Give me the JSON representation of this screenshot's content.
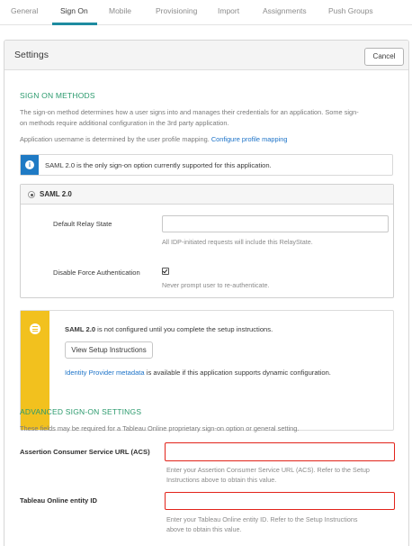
{
  "tabs": [
    {
      "label": "General"
    },
    {
      "label": "Sign On"
    },
    {
      "label": "Mobile"
    },
    {
      "label": "Provisioning"
    },
    {
      "label": "Import"
    },
    {
      "label": "Assignments"
    },
    {
      "label": "Push Groups"
    }
  ],
  "active_tab": "Sign On",
  "panel": {
    "title": "Settings",
    "cancel_label": "Cancel"
  },
  "sign_on_methods": {
    "heading": "SIGN ON METHODS",
    "description_line1": "The sign-on method determines how a user signs into and manages their credentials for an application. Some sign-",
    "description_line2": "on methods require additional configuration in the 3rd party application.",
    "username_text": "Application username is determined by the user profile mapping.",
    "username_link": "Configure profile mapping"
  },
  "info_box": {
    "icon": "info-icon",
    "text": "SAML 2.0 is the only sign-on option currently supported for this application."
  },
  "saml": {
    "label": "SAML 2.0",
    "selected": true,
    "relay_state_label": "Default Relay State",
    "relay_state_value": "",
    "relay_state_hint": "All IDP-initiated requests will include this RelayState.",
    "disable_force_auth_label": "Disable Force Authentication",
    "disable_force_auth_checked": true,
    "disable_force_auth_hint": "Never prompt user to re-authenticate."
  },
  "warning_box": {
    "icon": "list-icon",
    "text_strong": "SAML 2.0",
    "text_rest": " is not configured until you complete the setup instructions.",
    "button_label": "View Setup Instructions",
    "metadata_link": "Identity Provider metadata",
    "metadata_rest": " is available if this application supports dynamic configuration."
  },
  "advanced": {
    "heading": "ADVANCED SIGN-ON SETTINGS",
    "description": "These fields may be required for a Tableau Online proprietary sign-on option or general setting.",
    "acs_label": "Assertion Consumer Service URL (ACS)",
    "acs_value": "",
    "acs_hint_line1": "Enter your Assertion Consumer Service URL (ACS). Refer to the Setup",
    "acs_hint_line2": "Instructions above to obtain this value.",
    "entity_label": "Tableau Online entity ID",
    "entity_value": "",
    "entity_hint_line1": "Enter your Tableau Online entity ID. Refer to the Setup Instructions",
    "entity_hint_line2": "above to obtain this value."
  },
  "colors": {
    "accent_teal": "#1d8ba0",
    "section_green": "#2b9a6d",
    "info_blue": "#1f7ac4",
    "warning_yellow": "#f2c11e",
    "error_red": "#e2231a",
    "link_blue": "#1d73c8"
  }
}
